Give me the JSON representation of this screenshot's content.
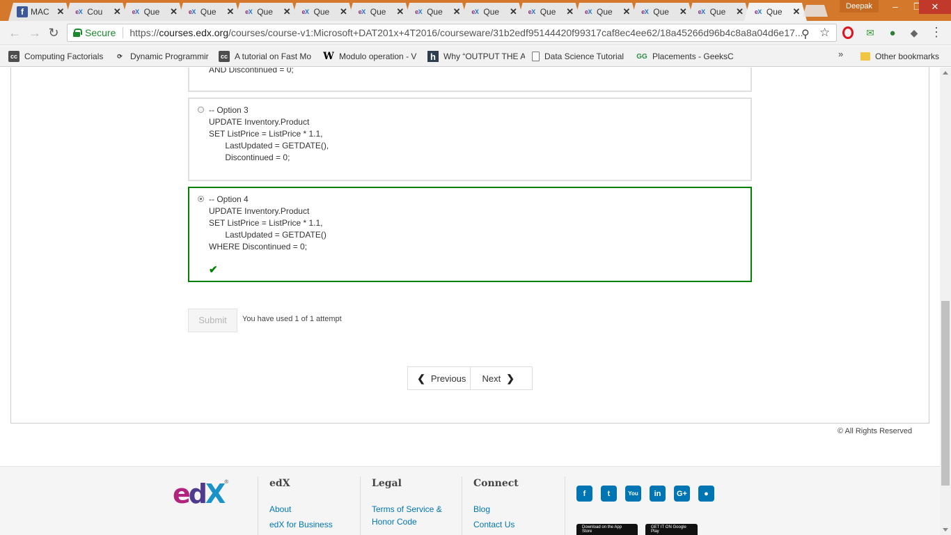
{
  "browser": {
    "tabs": [
      {
        "favicon": "facebook-icon",
        "title": "MAC"
      },
      {
        "favicon": "edx-icon",
        "title": "Cou"
      },
      {
        "favicon": "edx-icon",
        "title": "Que"
      },
      {
        "favicon": "edx-icon",
        "title": "Que"
      },
      {
        "favicon": "edx-icon",
        "title": "Que"
      },
      {
        "favicon": "edx-icon",
        "title": "Que"
      },
      {
        "favicon": "edx-icon",
        "title": "Que"
      },
      {
        "favicon": "edx-icon",
        "title": "Que"
      },
      {
        "favicon": "edx-icon",
        "title": "Que"
      },
      {
        "favicon": "edx-icon",
        "title": "Que"
      },
      {
        "favicon": "edx-icon",
        "title": "Que"
      },
      {
        "favicon": "edx-icon",
        "title": "Que"
      },
      {
        "favicon": "edx-icon",
        "title": "Que"
      },
      {
        "favicon": "edx-icon",
        "title": "Que",
        "active": true
      }
    ],
    "profile_name": "Deepak",
    "security_label": "Secure",
    "url_scheme": "https://",
    "url_host": "courses.edx.org",
    "url_path": "/courses/course-v1:Microsoft+DAT201x+4T2016/courseware/31b2edf95144420f99317caf8ec4ee62/18a45266d96b4c8a8a04d6e17...",
    "accent_color": "#d4792b"
  },
  "bookmarks": {
    "items": [
      {
        "icon": "cc-icon",
        "label": "Computing Factorials"
      },
      {
        "icon": "dynamic-programming-icon",
        "label": "Dynamic Programmir"
      },
      {
        "icon": "cc-icon",
        "label": "A tutorial on Fast Mo"
      },
      {
        "icon": "wikipedia-icon",
        "label": "Modulo operation - V"
      },
      {
        "icon": "hackerrank-icon",
        "label": "Why “OUTPUT THE A"
      },
      {
        "icon": "document-icon",
        "label": "Data Science Tutorial"
      },
      {
        "icon": "geeksforgeeks-icon",
        "label": "Placements - GeeksC"
      }
    ],
    "overflow": "»",
    "other": "Other bookmarks"
  },
  "question": {
    "option2_tail": "AND Discontinued = 0;",
    "option3": "-- Option 3\nUPDATE Inventory.Product\nSET ListPrice = ListPrice * 1.1,\n       LastUpdated = GETDATE(),\n       Discontinued = 0;",
    "option4": "-- Option 4\nUPDATE Inventory.Product\nSET ListPrice = ListPrice * 1.1,\n       LastUpdated = GETDATE()\nWHERE Discontinued = 0;",
    "selected_option": 4,
    "correct_color": "#008100",
    "submit_label": "Submit",
    "attempts_text": "You have used 1 of 1 attempt"
  },
  "pager": {
    "previous": "Previous",
    "next": "Next"
  },
  "copyright": "© All Rights Reserved",
  "footer": {
    "brand": "edX",
    "columns": [
      {
        "heading": "edX",
        "links": [
          "About",
          "edX for Business"
        ]
      },
      {
        "heading": "Legal",
        "links": [
          "Terms of Service & Honor Code"
        ]
      },
      {
        "heading": "Connect",
        "links": [
          "Blog",
          "Contact Us"
        ]
      }
    ],
    "social": [
      "facebook-icon",
      "twitter-icon",
      "youtube-icon",
      "linkedin-icon",
      "google-plus-icon",
      "reddit-icon"
    ],
    "app_store": "Download on the App Store",
    "google_play": "GET IT ON Google Play"
  }
}
